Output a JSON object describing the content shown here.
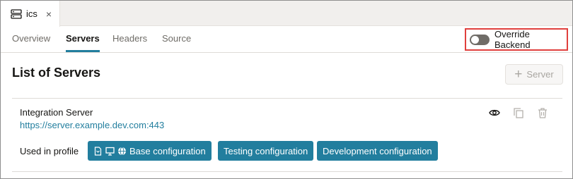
{
  "document_tab": {
    "title": "ics",
    "close_glyph": "×",
    "icon": "server-icon"
  },
  "nav": {
    "tabs": [
      {
        "label": "Overview",
        "active": false
      },
      {
        "label": "Servers",
        "active": true
      },
      {
        "label": "Headers",
        "active": false
      },
      {
        "label": "Source",
        "active": false
      }
    ],
    "override": {
      "label": "Override Backend",
      "checked": false,
      "highlight_color": "#e0403d"
    }
  },
  "main": {
    "title": "List of Servers",
    "add_button": {
      "icon_glyph": "+",
      "label": "Server",
      "disabled": true
    }
  },
  "server": {
    "name": "Integration Server",
    "url": "https://server.example.dev.com:443",
    "actions": [
      "eye-icon",
      "copy-icon",
      "trash-icon"
    ],
    "used_in_label": "Used in profile",
    "profiles": [
      {
        "label": "Base configuration",
        "icons": [
          "document-icon",
          "monitor-icon",
          "globe-icon"
        ]
      },
      {
        "label": "Testing configuration"
      },
      {
        "label": "Development configuration"
      }
    ]
  },
  "colors": {
    "accent": "#227e9e",
    "text": "#161513",
    "muted": "#6f6c67"
  }
}
